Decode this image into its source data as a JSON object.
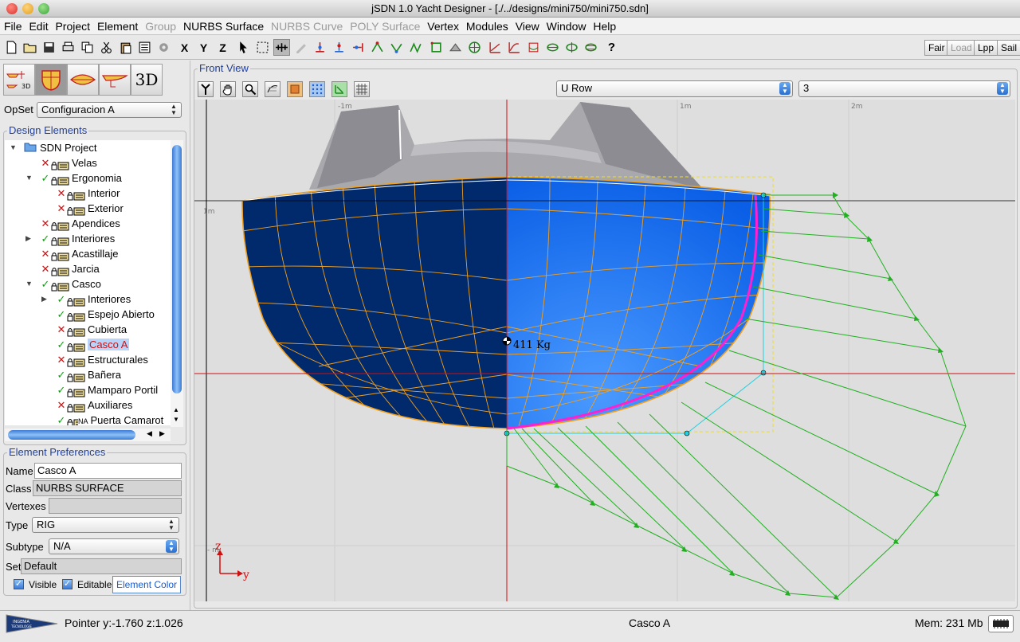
{
  "window": {
    "title": "jSDN 1.0 Yacht Designer - [./../designs/mini750/mini750.sdn]"
  },
  "menu": [
    {
      "label": "File",
      "enabled": true
    },
    {
      "label": "Edit",
      "enabled": true
    },
    {
      "label": "Project",
      "enabled": true
    },
    {
      "label": "Element",
      "enabled": true
    },
    {
      "label": "Group",
      "enabled": false
    },
    {
      "label": "NURBS Surface",
      "enabled": true
    },
    {
      "label": "NURBS Curve",
      "enabled": false
    },
    {
      "label": "POLY Surface",
      "enabled": false
    },
    {
      "label": "Vertex",
      "enabled": true
    },
    {
      "label": "Modules",
      "enabled": true
    },
    {
      "label": "View",
      "enabled": true
    },
    {
      "label": "Window",
      "enabled": true
    },
    {
      "label": "Help",
      "enabled": true
    }
  ],
  "toolbar": {
    "right_buttons": [
      "Fair",
      "Load",
      "Lpp",
      "Sail"
    ],
    "axis_x": "X",
    "axis_y": "Y",
    "axis_z": "Z",
    "help": "?"
  },
  "modes": {
    "three_d_label": "3D",
    "mini_3d": "3D"
  },
  "opset": {
    "label": "OpSet",
    "value": "Configuracion A"
  },
  "design_elements": {
    "title": "Design Elements",
    "tree": [
      {
        "label": "SDN Project",
        "level": 0,
        "expander": "open",
        "status": "folder"
      },
      {
        "label": "Velas",
        "level": 1,
        "expander": "none",
        "status": "x"
      },
      {
        "label": "Ergonomia",
        "level": 1,
        "expander": "open",
        "status": "check"
      },
      {
        "label": "Interior",
        "level": 2,
        "expander": "none",
        "status": "x"
      },
      {
        "label": "Exterior",
        "level": 2,
        "expander": "none",
        "status": "x"
      },
      {
        "label": "Apendices",
        "level": 1,
        "expander": "none",
        "status": "x"
      },
      {
        "label": "Interiores",
        "level": 1,
        "expander": "closed",
        "status": "check"
      },
      {
        "label": "Acastillaje",
        "level": 1,
        "expander": "none",
        "status": "x"
      },
      {
        "label": "Jarcia",
        "level": 1,
        "expander": "none",
        "status": "x"
      },
      {
        "label": "Casco",
        "level": 1,
        "expander": "open",
        "status": "check"
      },
      {
        "label": "Interiores",
        "level": 2,
        "expander": "closed",
        "status": "check"
      },
      {
        "label": "Espejo Abierto",
        "level": 2,
        "expander": "none",
        "status": "check"
      },
      {
        "label": "Cubierta",
        "level": 2,
        "expander": "none",
        "status": "x"
      },
      {
        "label": "Casco A",
        "level": 2,
        "expander": "none",
        "status": "check",
        "selected": true
      },
      {
        "label": "Estructurales",
        "level": 2,
        "expander": "none",
        "status": "x"
      },
      {
        "label": "Bañera",
        "level": 2,
        "expander": "none",
        "status": "check"
      },
      {
        "label": "Mamparo Portil",
        "level": 2,
        "expander": "none",
        "status": "check"
      },
      {
        "label": "Auxiliares",
        "level": 2,
        "expander": "none",
        "status": "x"
      },
      {
        "label": "Puerta Camarot",
        "level": 2,
        "expander": "none",
        "status": "check",
        "tag": "NA"
      }
    ]
  },
  "element_preferences": {
    "title": "Element Preferences",
    "name_label": "Name",
    "name_value": "Casco A",
    "class_label": "Class",
    "class_value": "NURBS SURFACE",
    "vertexes_label": "Vertexes",
    "vertexes_value": "",
    "type_label": "Type",
    "type_value": "RIG",
    "subtype_label": "Subtype",
    "subtype_value": "N/A",
    "set_label": "Set",
    "set_value": "Default",
    "visible_label": "Visible",
    "visible": true,
    "editable_label": "Editable",
    "editable": true,
    "color_button": "Element Color"
  },
  "view": {
    "title": "Front View",
    "row_selector": "U Row",
    "row_number": "3",
    "axis_labels": {
      "x_neg": "-1m",
      "x_pos1": "1m",
      "x_pos2": "2m",
      "y_label": "1m",
      "y_neg": "- m",
      "z": "z",
      "y": "y"
    },
    "mass_label": "411 Kg"
  },
  "status": {
    "pointer": "Pointer y:-1.760 z:1.026",
    "selected": "Casco A",
    "memory": "Mem: 231 Mb",
    "logo_top": "INGENIA",
    "logo_bottom": "TECNOLOGIE"
  },
  "colors": {
    "hull_dark": "#002a6c",
    "hull_light": "#0a5fe6",
    "wire": "#f0a020",
    "curve": "#ff20d0",
    "force": "#20b020",
    "cyan": "#20d0e0",
    "axis_red": "#d01010"
  }
}
